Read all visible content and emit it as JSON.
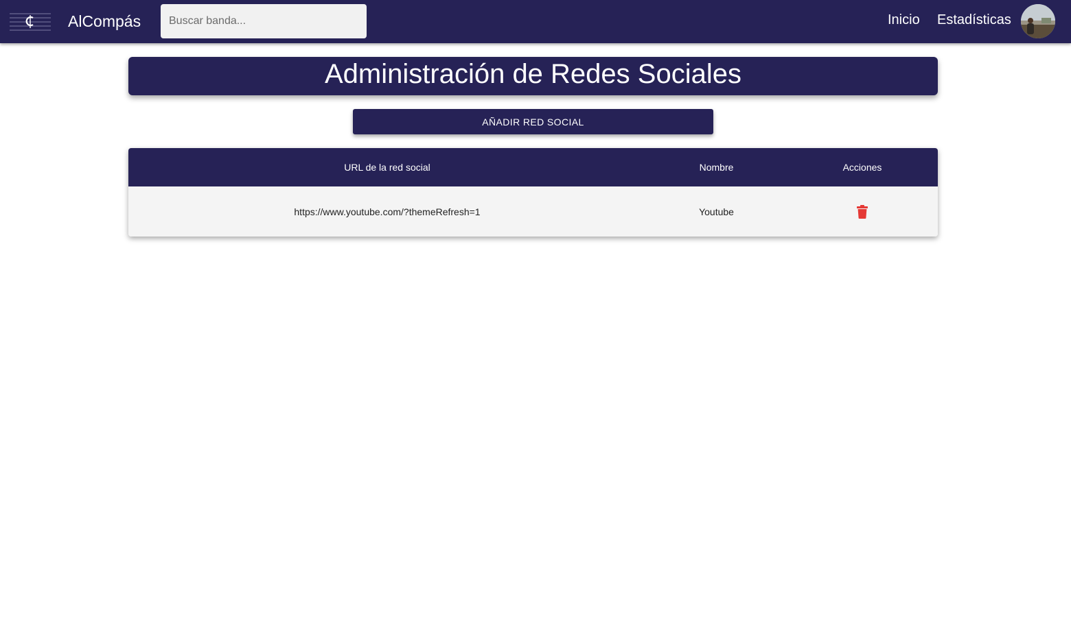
{
  "navbar": {
    "brand": "AlCompás",
    "search_placeholder": "Buscar banda...",
    "links": [
      "Inicio",
      "Estadísticas"
    ],
    "background": "#262256"
  },
  "page": {
    "title": "Administración de Redes Sociales",
    "add_button_label": "AÑADIR RED SOCIAL"
  },
  "table": {
    "headers": [
      "URL de la red social",
      "Nombre",
      "Acciones"
    ],
    "rows": [
      {
        "url": "https://www.youtube.com/?themeRefresh=1",
        "name": "Youtube",
        "action_icon": "trash-icon"
      }
    ],
    "delete_color": "#e53935"
  }
}
